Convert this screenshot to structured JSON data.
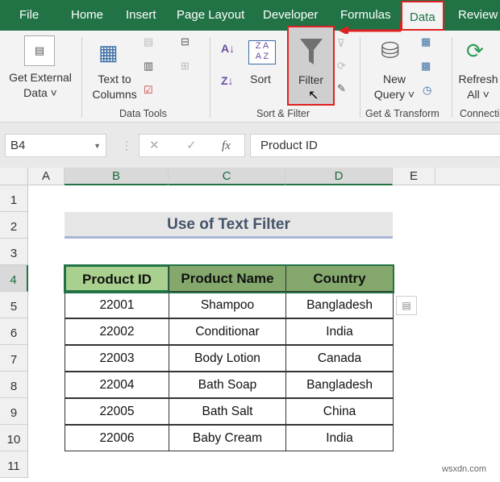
{
  "tabs": [
    "File",
    "Home",
    "Insert",
    "Page Layout",
    "Developer",
    "Formulas",
    "Data",
    "Review"
  ],
  "active_tab": "Data",
  "ribbon": {
    "get_external_data": [
      "Get External",
      "Data ˅"
    ],
    "text_to_columns": [
      "Text to",
      "Columns"
    ],
    "data_tools_label": "Data Tools",
    "sort_label": "Sort",
    "filter_label": "Filter",
    "sort_filter_label": "Sort & Filter",
    "new_query": [
      "New",
      "Query ˅"
    ],
    "get_transform_label": "Get & Transform",
    "refresh_all": [
      "Refresh",
      "All ˅"
    ],
    "connections_label": "Connecti"
  },
  "formula_bar": {
    "name_box": "B4",
    "fx": "fx",
    "cancel": "✕",
    "enter": "✓",
    "value": "Product ID"
  },
  "columns": [
    "A",
    "B",
    "C",
    "D",
    "E"
  ],
  "rows": [
    "1",
    "2",
    "3",
    "4",
    "5",
    "6",
    "7",
    "8",
    "9",
    "10",
    "11"
  ],
  "sheet": {
    "title": "Use of Text Filter",
    "headers": [
      "Product ID",
      "Product Name",
      "Country"
    ],
    "data": [
      [
        "22001",
        "Shampoo",
        "Bangladesh"
      ],
      [
        "22002",
        "Conditionar",
        "India"
      ],
      [
        "22003",
        "Body Lotion",
        "Canada"
      ],
      [
        "22004",
        "Bath Soap",
        "Bangladesh"
      ],
      [
        "22005",
        "Bath Salt",
        "China"
      ],
      [
        "22006",
        "Baby Cream",
        "India"
      ]
    ]
  },
  "watermark": "wsxdn.com",
  "colors": {
    "brand": "#217346",
    "highlight": "#e02020",
    "header_light": "#a9d08e",
    "header_dark": "#84a86c"
  }
}
